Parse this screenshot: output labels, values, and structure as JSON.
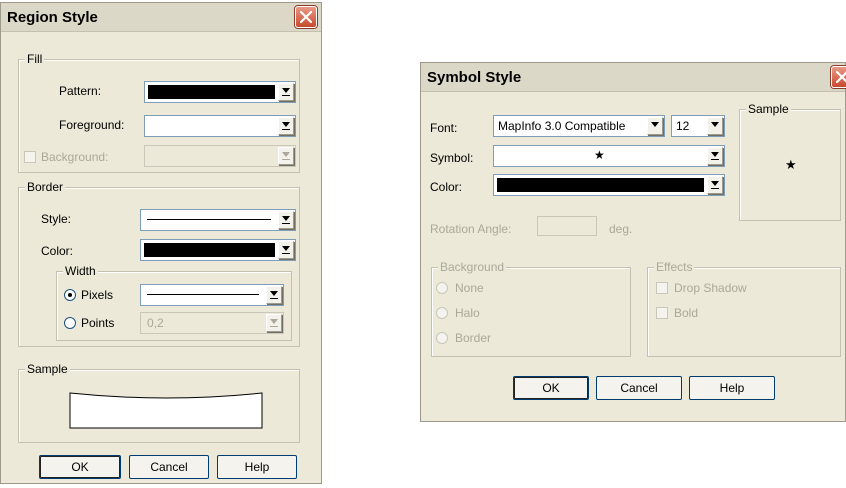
{
  "region_style": {
    "title": "Region Style",
    "fill": {
      "legend": "Fill",
      "pattern_label": "Pattern:",
      "foreground_label": "Foreground:",
      "background_label": "Background:"
    },
    "border": {
      "legend": "Border",
      "style_label": "Style:",
      "color_label": "Color:",
      "width": {
        "legend": "Width",
        "pixels_label": "Pixels",
        "points_label": "Points",
        "points_value": "0,2",
        "selected": "Pixels"
      }
    },
    "sample_legend": "Sample",
    "buttons": {
      "ok": "OK",
      "cancel": "Cancel",
      "help": "Help"
    }
  },
  "symbol_style": {
    "title": "Symbol Style",
    "font_label": "Font:",
    "font_value": "MapInfo 3.0 Compatible",
    "size_value": "12",
    "symbol_label": "Symbol:",
    "symbol_glyph": "★",
    "color_label": "Color:",
    "rotation_label": "Rotation Angle:",
    "rotation_unit": "deg.",
    "sample_legend": "Sample",
    "sample_glyph": "★",
    "background": {
      "legend": "Background",
      "options": [
        "None",
        "Halo",
        "Border"
      ]
    },
    "effects": {
      "legend": "Effects",
      "drop_shadow_label": "Drop Shadow",
      "bold_label": "Bold"
    },
    "buttons": {
      "ok": "OK",
      "cancel": "Cancel",
      "help": "Help"
    }
  },
  "colors": {
    "dialog_bg": "#ece9d8",
    "close_button": "#c84a2e",
    "disabled_text": "#aca899",
    "swatch_black": "#000000"
  },
  "icons": {
    "close": "close-icon",
    "dropdown": "chevron-down-icon",
    "star": "star-icon"
  }
}
